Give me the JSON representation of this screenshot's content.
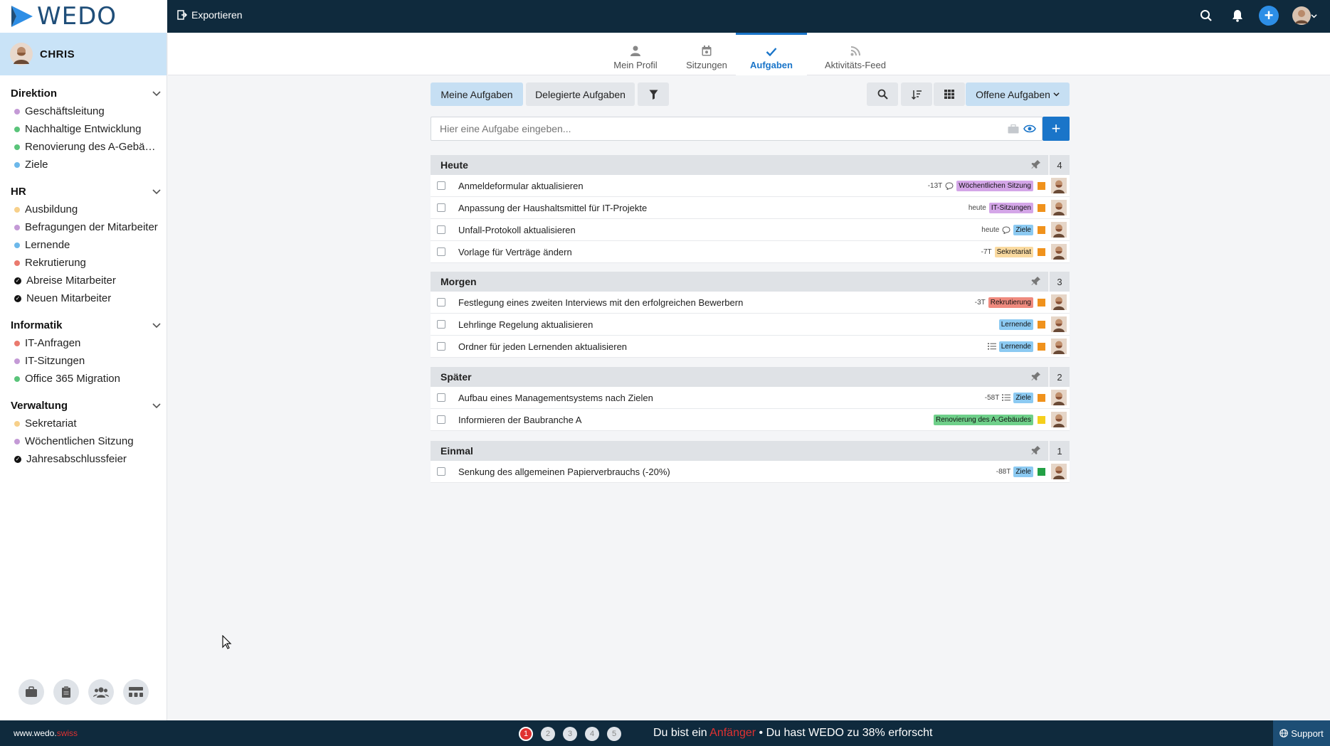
{
  "app": {
    "brand": "WEDO",
    "export_label": "Exportieren"
  },
  "user": {
    "name": "CHRIS"
  },
  "sidebar": {
    "groups": [
      {
        "title": "Direktion",
        "items": [
          {
            "label": "Geschäftsleitung",
            "color": "#c49ad6",
            "kind": "dot"
          },
          {
            "label": "Nachhaltige Entwicklung",
            "color": "#5ac47a",
            "kind": "dot"
          },
          {
            "label": "Renovierung des A-Gebäudes",
            "color": "#5ac47a",
            "kind": "dot"
          },
          {
            "label": "Ziele",
            "color": "#6cb8ea",
            "kind": "dot"
          }
        ]
      },
      {
        "title": "HR",
        "items": [
          {
            "label": "Ausbildung",
            "color": "#f7d08a",
            "kind": "dot"
          },
          {
            "label": "Befragungen der Mitarbeiter",
            "color": "#c49ad6",
            "kind": "dot"
          },
          {
            "label": "Lernende",
            "color": "#6cb8ea",
            "kind": "dot"
          },
          {
            "label": "Rekrutierung",
            "color": "#ea7a6e",
            "kind": "dot"
          },
          {
            "label": "Abreise Mitarbeiter",
            "color": "#111111",
            "kind": "check"
          },
          {
            "label": "Neuen Mitarbeiter",
            "color": "#111111",
            "kind": "check"
          }
        ]
      },
      {
        "title": "Informatik",
        "items": [
          {
            "label": "IT-Anfragen",
            "color": "#ea7a6e",
            "kind": "dot"
          },
          {
            "label": "IT-Sitzungen",
            "color": "#c49ad6",
            "kind": "dot"
          },
          {
            "label": "Office 365 Migration",
            "color": "#5ac47a",
            "kind": "dot"
          }
        ]
      },
      {
        "title": "Verwaltung",
        "items": [
          {
            "label": "Sekretariat",
            "color": "#f7d08a",
            "kind": "dot"
          },
          {
            "label": "Wöchentlichen Sitzung",
            "color": "#c49ad6",
            "kind": "dot"
          },
          {
            "label": "Jahresabschlussfeier",
            "color": "#111111",
            "kind": "check"
          }
        ]
      }
    ]
  },
  "tabs": [
    {
      "label": "Mein Profil",
      "icon": "person-icon",
      "active": false
    },
    {
      "label": "Sitzungen",
      "icon": "calendar-icon",
      "active": false
    },
    {
      "label": "Aufgaben",
      "icon": "check-icon",
      "active": true
    },
    {
      "label": "Aktivitäts-Feed",
      "icon": "rss-icon",
      "active": false
    }
  ],
  "toolbar": {
    "my_tasks": "Meine Aufgaben",
    "delegated": "Delegierte Aufgaben",
    "filter_open": "Offene Aufgaben",
    "input_placeholder": "Hier eine Aufgabe eingeben...",
    "add_symbol": "+"
  },
  "sections": [
    {
      "title": "Heute",
      "count": "4",
      "rows": [
        {
          "title": "Anmeldeformular aktualisieren",
          "due": "-13T",
          "icon": "comment",
          "tag": "Wöchentlichen Sitzung",
          "tag_color": "#d4a6e8",
          "prio": "#f0921c"
        },
        {
          "title": "Anpassung der Haushaltsmittel für IT-Projekte",
          "due": "heute",
          "icon": "",
          "tag": "IT-Sitzungen",
          "tag_color": "#d4a6e8",
          "prio": "#f0921c"
        },
        {
          "title": "Unfall-Protokoll aktualisieren",
          "due": "heute",
          "icon": "comment",
          "tag": "Ziele",
          "tag_color": "#8ccaf2",
          "prio": "#f0921c"
        },
        {
          "title": "Vorlage für Verträge ändern",
          "due": "-7T",
          "icon": "",
          "tag": "Sekretariat",
          "tag_color": "#fadaa0",
          "prio": "#f0921c"
        }
      ]
    },
    {
      "title": "Morgen",
      "count": "3",
      "rows": [
        {
          "title": "Festlegung eines zweiten Interviews mit den erfolgreichen Bewerbern",
          "due": "-3T",
          "icon": "",
          "tag": "Rekrutierung",
          "tag_color": "#ef8a7e",
          "prio": "#f0921c"
        },
        {
          "title": "Lehrlinge Regelung aktualisieren",
          "due": "",
          "icon": "",
          "tag": "Lernende",
          "tag_color": "#8ccaf2",
          "prio": "#f0921c"
        },
        {
          "title": "Ordner für jeden Lernenden aktualisieren",
          "due": "",
          "icon": "list",
          "tag": "Lernende",
          "tag_color": "#8ccaf2",
          "prio": "#f0921c"
        }
      ]
    },
    {
      "title": "Später",
      "count": "2",
      "rows": [
        {
          "title": "Aufbau eines Managementsystems nach Zielen",
          "due": "-58T",
          "icon": "list",
          "tag": "Ziele",
          "tag_color": "#8ccaf2",
          "prio": "#f0921c"
        },
        {
          "title": "Informieren der Baubranche A",
          "due": "",
          "icon": "",
          "tag": "Renovierung des A-Gebäudes",
          "tag_color": "#6fd08a",
          "prio": "#f5cf1c"
        }
      ]
    },
    {
      "title": "Einmal",
      "count": "1",
      "rows": [
        {
          "title": "Senkung des allgemeinen Papierverbrauchs (-20%)",
          "due": "-88T",
          "icon": "",
          "tag": "Ziele",
          "tag_color": "#8ccaf2",
          "prio": "#22a045"
        }
      ]
    }
  ],
  "footer": {
    "site_prefix": "www.wedo.",
    "site_suffix": "swiss",
    "steps": [
      "1",
      "2",
      "3",
      "4",
      "5"
    ],
    "progress_a": "Du bist ein",
    "progress_level": "Anfänger",
    "progress_b": "• Du hast WEDO zu 38% erforscht",
    "support": "Support"
  }
}
